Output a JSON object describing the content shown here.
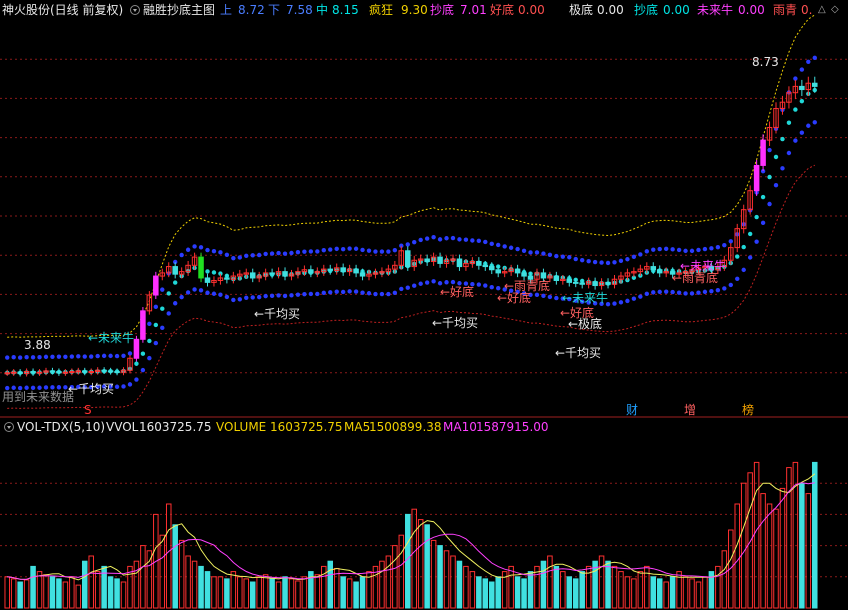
{
  "header": {
    "title": "神火股份(日线 前复权)",
    "indicator": "融胜抄底主图",
    "items": [
      {
        "label": "上",
        "value": "8.72",
        "color": "#4a7dff"
      },
      {
        "label": "下",
        "value": "7.58",
        "color": "#4a7dff"
      },
      {
        "label": "中",
        "value": "8.15",
        "color": "#00e5e5"
      },
      {
        "label": "疯狂",
        "value": "9.30",
        "color": "#f0d000"
      },
      {
        "label": "抄底",
        "value": "7.01",
        "color": "#ff40ff"
      },
      {
        "label": "好底",
        "value": "0.00",
        "color": "#ff5050"
      },
      {
        "label": "极底",
        "value": "0.00",
        "color": "#e8e8e8"
      },
      {
        "label": "抄底",
        "value": "0.00",
        "color": "#00e5e5"
      },
      {
        "label": "未来牛",
        "value": "0.00",
        "color": "#ff40ff"
      },
      {
        "label": "雨青",
        "value": "0.",
        "color": "#ff5050"
      }
    ],
    "right_icons": [
      "up-arrow-icon",
      "diamond-icon"
    ]
  },
  "volume_header": {
    "name": "VOL-TDX(5,10)",
    "items": [
      {
        "label": "VVOL",
        "value": "1603725.75",
        "color": "#e8e8e8"
      },
      {
        "label": "VOLUME",
        "value": "1603725.75",
        "color": "#f0d000"
      },
      {
        "label": "MA5",
        "value": "1500899.38",
        "color": "#f0d000"
      },
      {
        "label": "MA10",
        "value": "1587915.00",
        "color": "#ff40ff"
      }
    ]
  },
  "chart_data": [
    {
      "type": "candlestick",
      "title": "融胜抄底主图",
      "ylim": [
        3.4,
        9.6
      ],
      "annotations": {
        "high_label": "8.73",
        "low_label": "3.88",
        "signals": [
          "←未来牛",
          "←千均买",
          "←好底",
          "←好底",
          "←雨青底",
          "←未来牛",
          "←好底",
          "←极底",
          "←千均买",
          "←千均买",
          "←千均买",
          "←雨青底",
          "←未来牛"
        ],
        "footer_note": "用到未来数据",
        "markers": [
          "S",
          "财",
          "增",
          "榜"
        ]
      },
      "closes": [
        4.02,
        4.03,
        4.01,
        4.04,
        4.02,
        4.03,
        4.05,
        4.04,
        4.02,
        4.03,
        4.04,
        4.05,
        4.03,
        4.04,
        4.06,
        4.05,
        4.04,
        4.03,
        4.06,
        4.25,
        4.55,
        5.0,
        5.25,
        5.55,
        5.6,
        5.7,
        5.58,
        5.62,
        5.72,
        5.85,
        5.52,
        5.45,
        5.48,
        5.52,
        5.5,
        5.55,
        5.58,
        5.6,
        5.52,
        5.55,
        5.6,
        5.58,
        5.62,
        5.55,
        5.58,
        5.62,
        5.65,
        5.6,
        5.62,
        5.66,
        5.64,
        5.68,
        5.62,
        5.66,
        5.6,
        5.55,
        5.58,
        5.6,
        5.62,
        5.66,
        5.72,
        5.95,
        5.7,
        5.8,
        5.82,
        5.78,
        5.85,
        5.75,
        5.8,
        5.82,
        5.7,
        5.75,
        5.78,
        5.72,
        5.7,
        5.65,
        5.6,
        5.62,
        5.66,
        5.6,
        5.55,
        5.5,
        5.6,
        5.52,
        5.55,
        5.48,
        5.5,
        5.45,
        5.44,
        5.42,
        5.46,
        5.4,
        5.45,
        5.42,
        5.5,
        5.55,
        5.6,
        5.62,
        5.66,
        5.7,
        5.65,
        5.6,
        5.62,
        5.58,
        5.6,
        5.62,
        5.65,
        5.68,
        5.7,
        5.65,
        5.7,
        5.8,
        6.0,
        6.3,
        6.6,
        6.9,
        7.3,
        7.7,
        7.9,
        8.2,
        8.3,
        8.45,
        8.55,
        8.5,
        8.6,
        8.55
      ],
      "volume": {
        "ylabel": "VOL",
        "ma_windows": [
          5,
          10
        ],
        "values": [
          30,
          28,
          25,
          27,
          40,
          35,
          32,
          30,
          28,
          25,
          30,
          22,
          45,
          50,
          35,
          40,
          30,
          28,
          25,
          40,
          45,
          60,
          55,
          90,
          70,
          100,
          80,
          65,
          50,
          45,
          40,
          35,
          30,
          30,
          28,
          35,
          30,
          28,
          25,
          30,
          32,
          28,
          25,
          30,
          28,
          26,
          30,
          35,
          32,
          40,
          45,
          38,
          30,
          28,
          25,
          30,
          35,
          40,
          45,
          50,
          60,
          70,
          90,
          95,
          85,
          80,
          65,
          60,
          55,
          50,
          45,
          40,
          35,
          30,
          28,
          25,
          30,
          35,
          40,
          30,
          28,
          35,
          40,
          45,
          50,
          40,
          35,
          30,
          28,
          35,
          40,
          45,
          50,
          45,
          40,
          35,
          30,
          28,
          35,
          40,
          30,
          28,
          25,
          30,
          35,
          30,
          28,
          25,
          30,
          35,
          40,
          55,
          75,
          100,
          120,
          130,
          140,
          110,
          100,
          95,
          115,
          135,
          140,
          120,
          110,
          140
        ],
        "colors": "red=up, cyan=down"
      }
    }
  ]
}
